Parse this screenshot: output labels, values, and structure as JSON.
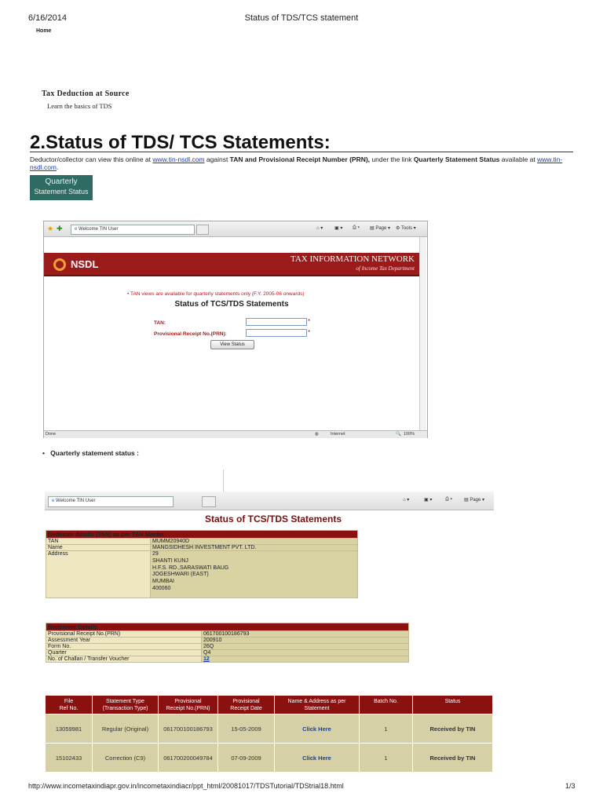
{
  "print_header": {
    "date": "6/16/2014",
    "title": "Status of TDS/TCS statement",
    "home": "Home"
  },
  "intro": {
    "heading": "Tax Deduction at Source",
    "subheading": "Learn the basics of TDS"
  },
  "section_title": "2.Status of TDS/ TCS Statements:",
  "paragraph": {
    "p1": "Deductor/collector can view this online at ",
    "link1": "www.tin-nsdl.com",
    "p2": " against ",
    "bold1": "TAN and Provisional Receipt Number (PRN),",
    "p3": " under the link ",
    "bold2": "Quarterly Statement Status",
    "p4": " available at ",
    "link2": "www.tin-nsdl.com",
    "p5": "."
  },
  "quarterly_button": {
    "line1": "Quarterly",
    "line2": "Statement Status"
  },
  "shot1": {
    "tab_title": "Welcome TIN User",
    "toolbar": {
      "page": "Page",
      "tools": "Tools"
    },
    "logo_text": "NSDL",
    "banner_title": "TAX INFORMATION NETWORK",
    "banner_sub": "of Income Tax Department",
    "notice": "TAN views are available for quarterly statements only (F.Y. 2005-06 onwards)",
    "form_title": "Status of TCS/TDS Statements",
    "label_tan": "TAN:",
    "label_prn": "Provisional Receipt No.(PRN):",
    "star": "*",
    "button": "View Status",
    "status_left": "Done",
    "status_zone": "Internet",
    "status_zoom": "100%"
  },
  "bullet_text": "Quarterly statement status :",
  "shot2": {
    "tab_title": "Welcome TIN User",
    "toolbar_page": "Page",
    "title": "Status of TCS/TDS Statements",
    "deductor": {
      "header": "Deductor details (TAN) as per TAN Master",
      "rows": [
        {
          "label": "TAN",
          "value": "MUMM20940D"
        },
        {
          "label": "Name",
          "value": "MANGSIDHESH INVESTMENT PVT. LTD."
        }
      ],
      "address_label": "Address",
      "address_lines": [
        "29",
        "SHANTI KUNJ",
        "H.F.S. RD.,SARASWATI BAUG",
        "JOGESHWARI (EAST)",
        "MUMBAI",
        "400060"
      ]
    },
    "statement": {
      "header": "Statement Details",
      "rows": [
        {
          "label": "Provisional Receipt No.(PRN)",
          "value": "061700100186793"
        },
        {
          "label": "Assessment Year",
          "value": "200910"
        },
        {
          "label": "Form No.",
          "value": "26Q"
        },
        {
          "label": "Quarter",
          "value": "Q4"
        },
        {
          "label": "No. of Challan / Transfer Voucher",
          "value": "12"
        }
      ]
    },
    "files": {
      "headers": [
        [
          "File",
          "Ref No."
        ],
        [
          "Statement Type",
          "(Transaction Type)"
        ],
        [
          "Provisional",
          "Receipt No.(PRN)"
        ],
        [
          "Provisional",
          "Receipt Date"
        ],
        [
          "Name & Address as per",
          "Statement"
        ],
        [
          "Batch No."
        ],
        [
          "Status"
        ]
      ],
      "rows": [
        {
          "ref": "13059981",
          "type": "Regular (Original)",
          "prn": "061700100186793",
          "date": "15-05-2009",
          "link": "Click Here",
          "batch": "1",
          "status": "Received by TIN"
        },
        {
          "ref": "15102433",
          "type": "Correction (C9)",
          "prn": "061700200049784",
          "date": "07-09-2009",
          "link": "Click Here",
          "batch": "1",
          "status": "Received by TIN"
        }
      ]
    }
  },
  "print_footer": {
    "url": "http://www.incometaxindiapr.gov.in/incometaxindiacr/ppt_html/20081017/TDSTutorial/TDStrial18.html",
    "page": "1/3"
  }
}
